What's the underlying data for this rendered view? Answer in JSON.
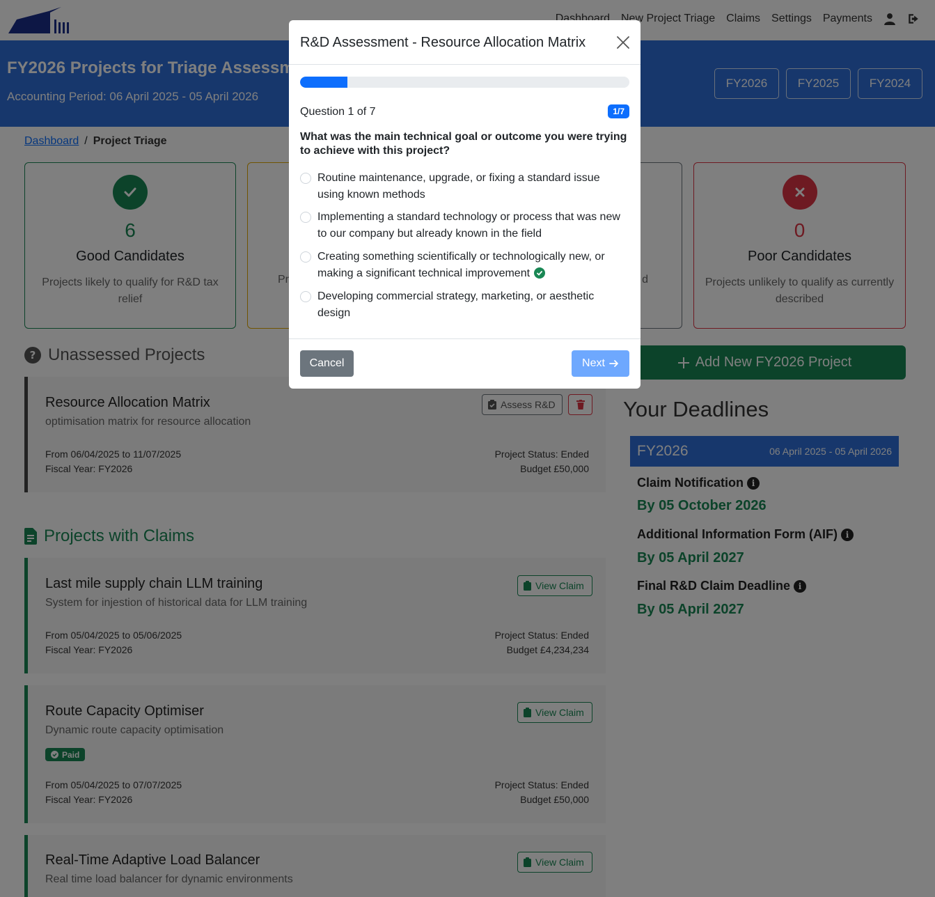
{
  "nav": {
    "links": [
      "Dashboard",
      "New Project Triage",
      "Claims",
      "Settings",
      "Payments"
    ],
    "icons": [
      "user-icon",
      "logout-icon"
    ]
  },
  "header": {
    "title": "FY2026 Projects for Triage Assessm",
    "subtitle": "Accounting Period: 06 April 2025 - 05 April 2026",
    "fy_buttons": [
      "FY2026",
      "FY2025",
      "FY2024"
    ],
    "bg_color": "#2f6fd8"
  },
  "breadcrumb": {
    "link": "Dashboard",
    "separator": "/",
    "current": "Project Triage"
  },
  "stats": {
    "good": {
      "count": "6",
      "label": "Good Candidates",
      "desc": "Projects likely to qualify for R&D tax relief",
      "color": "#198754"
    },
    "poor": {
      "count": "0",
      "label": "Poor Candidates",
      "desc": "Projects unlikely to qualify as currently described",
      "color": "#dc3545"
    },
    "partial_left": "Pr",
    "partial_right": "d"
  },
  "unassessed": {
    "heading": "Unassessed Projects",
    "projects": [
      {
        "title": "Resource Allocation Matrix",
        "desc": "optimisation matrix for resource allocation",
        "dates": "From 06/04/2025 to 11/07/2025",
        "fiscal": "Fiscal Year: FY2026",
        "status": "Project Status: Ended",
        "budget": "Budget £50,000",
        "assess_label": "Assess R&D"
      }
    ]
  },
  "claims": {
    "heading": "Projects with Claims",
    "view_label": "View Claim",
    "paid_label": "Paid",
    "projects": [
      {
        "title": "Last mile supply chain LLM training",
        "desc": "System for injestion of historical data for LLM training",
        "dates": "From 05/04/2025 to 05/06/2025",
        "fiscal": "Fiscal Year: FY2026",
        "status": "Project Status: Ended",
        "budget": "Budget £4,234,234"
      },
      {
        "title": "Route Capacity Optimiser",
        "desc": "Dynamic route capacity optimisation",
        "dates": "From 05/04/2025 to 07/07/2025",
        "fiscal": "Fiscal Year: FY2026",
        "status": "Project Status: Ended",
        "budget": "Budget £50,000"
      },
      {
        "title": "Real-Time Adaptive Load Balancer",
        "desc": "Real time load balancer for dynamic environments"
      }
    ]
  },
  "right": {
    "add_label": "Add New FY2026 Project",
    "deadlines_heading": "Your Deadlines",
    "fy": "FY2026",
    "period": "06 April 2025 - 05 April 2026",
    "items": [
      {
        "label": "Claim Notification",
        "date": "By 05 October 2026"
      },
      {
        "label": "Additional Information Form (AIF)",
        "date": "By 05 April 2027"
      },
      {
        "label": "Final R&D Claim Deadline",
        "date": "By 05 April 2027"
      }
    ]
  },
  "modal": {
    "title": "R&D Assessment - Resource Allocation Matrix",
    "progress_fraction": 0.143,
    "counter": "Question 1 of 7",
    "badge": "1/7",
    "question": "What was the main technical goal or outcome you were trying to achieve with this project?",
    "options": [
      "Routine maintenance, upgrade, or fixing a standard issue using known methods",
      "Implementing a standard technology or process that was new to our company but already known in the field",
      "Creating something scientifically or technologically new, or making a significant technical improvement",
      "Developing commercial strategy, marketing, or aesthetic design"
    ],
    "cancel_label": "Cancel",
    "next_label": "Next"
  }
}
